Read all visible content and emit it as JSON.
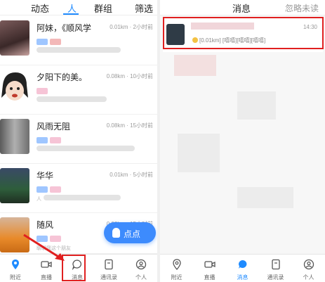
{
  "left": {
    "tabs": [
      "动态",
      "人",
      "群组",
      "筛选"
    ],
    "active_tab": "人",
    "rows": [
      {
        "name": "阿妹，《顺风学",
        "meta": "0.01km · 2小时前",
        "snippet": ""
      },
      {
        "name": "夕阳下的美。",
        "meta": "0.08km · 10小时前",
        "snippet": ""
      },
      {
        "name": "风雨无阻",
        "meta": "0.08km · 15小时前",
        "snippet": ""
      },
      {
        "name": "华华",
        "meta": "0.01km · 5小时前",
        "snippet": "人"
      },
      {
        "name": "随风",
        "meta": "0.08km · 15小时前",
        "snippet": "聊聊我这个朋友"
      }
    ],
    "float_button": "点点",
    "nav": [
      "附近",
      "直播",
      "消息",
      "通讯录",
      "个人"
    ],
    "active_nav": "消息"
  },
  "right": {
    "header": {
      "title": "消息",
      "action": "忽略未读"
    },
    "message": {
      "time": "14:30",
      "preview": "[0.01km] [嘻嘻][嘻嘻][嘻嘻]"
    },
    "nav": [
      "附近",
      "直播",
      "消息",
      "通讯录",
      "个人"
    ],
    "active_nav": "消息"
  },
  "colors": {
    "accent": "#1f8bff",
    "annotation": "#e02020",
    "float_button": "#3d8bfd"
  }
}
